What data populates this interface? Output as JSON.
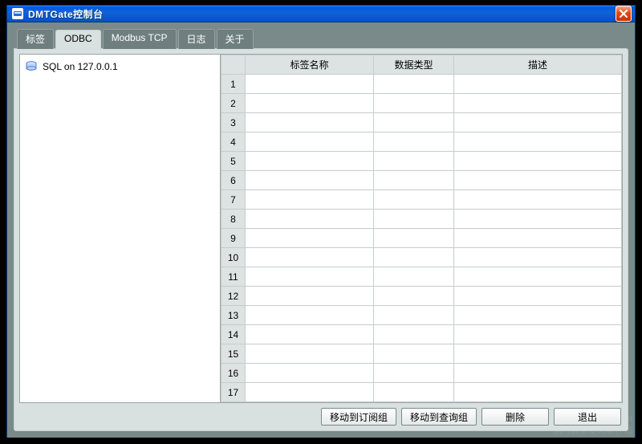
{
  "window": {
    "title": "DMTGate控制台"
  },
  "tabs": [
    {
      "label": "标签",
      "active": false
    },
    {
      "label": "ODBC",
      "active": true
    },
    {
      "label": "Modbus TCP",
      "active": false
    },
    {
      "label": "日志",
      "active": false
    },
    {
      "label": "关于",
      "active": false
    }
  ],
  "tree": {
    "items": [
      {
        "label": "SQL on 127.0.0.1"
      }
    ]
  },
  "grid": {
    "columns": [
      "标签名称",
      "数据类型",
      "描述"
    ],
    "row_count": 17
  },
  "buttons": {
    "move_subscribe": "移动到订阅组",
    "move_query": "移动到查询组",
    "delete": "删除",
    "exit": "退出"
  },
  "watermark": {
    "center": "www.DuoTe.com",
    "brand_main": "多特",
    "brand_sub": "DuoTe.Com",
    "brand_tag": "国内最安全的软件站"
  }
}
